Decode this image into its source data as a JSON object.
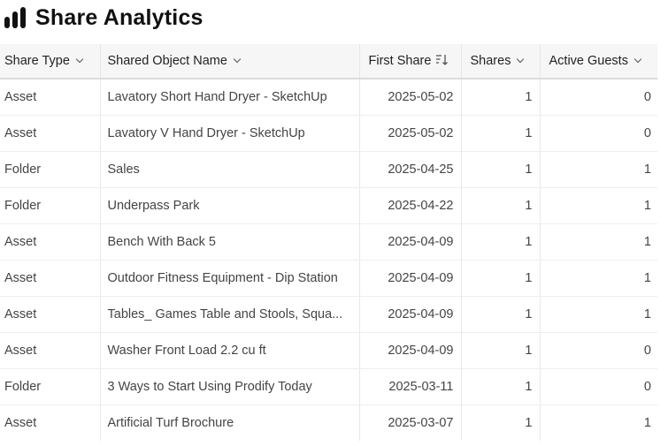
{
  "header": {
    "title": "Share Analytics",
    "icon": "bar-chart-icon"
  },
  "table": {
    "columns": [
      {
        "label": "Share Type",
        "control": "chevron-down-icon"
      },
      {
        "label": "Shared Object Name",
        "control": "chevron-down-icon"
      },
      {
        "label": "First Share",
        "control": "sort-descending-icon"
      },
      {
        "label": "Shares",
        "control": "chevron-down-icon"
      },
      {
        "label": "Active Guests",
        "control": "chevron-down-icon"
      }
    ],
    "rows": [
      {
        "type": "Asset",
        "name": "Lavatory Short Hand Dryer - SketchUp",
        "first_share": "2025-05-02",
        "shares": "1",
        "active_guests": "0"
      },
      {
        "type": "Asset",
        "name": "Lavatory V Hand Dryer - SketchUp",
        "first_share": "2025-05-02",
        "shares": "1",
        "active_guests": "0"
      },
      {
        "type": "Folder",
        "name": "Sales",
        "first_share": "2025-04-25",
        "shares": "1",
        "active_guests": "1"
      },
      {
        "type": "Folder",
        "name": "Underpass Park",
        "first_share": "2025-04-22",
        "shares": "1",
        "active_guests": "1"
      },
      {
        "type": "Asset",
        "name": "Bench With Back 5",
        "first_share": "2025-04-09",
        "shares": "1",
        "active_guests": "1"
      },
      {
        "type": "Asset",
        "name": "Outdoor Fitness Equipment - Dip Station",
        "first_share": "2025-04-09",
        "shares": "1",
        "active_guests": "1"
      },
      {
        "type": "Asset",
        "name": "Tables_ Games Table and Stools, Squa...",
        "first_share": "2025-04-09",
        "shares": "1",
        "active_guests": "1"
      },
      {
        "type": "Asset",
        "name": "Washer Front Load 2.2 cu ft",
        "first_share": "2025-04-09",
        "shares": "1",
        "active_guests": "0"
      },
      {
        "type": "Folder",
        "name": "3 Ways to Start Using Prodify Today",
        "first_share": "2025-03-11",
        "shares": "1",
        "active_guests": "0"
      },
      {
        "type": "Asset",
        "name": "Artificial Turf Brochure",
        "first_share": "2025-03-07",
        "shares": "1",
        "active_guests": "1"
      }
    ]
  }
}
